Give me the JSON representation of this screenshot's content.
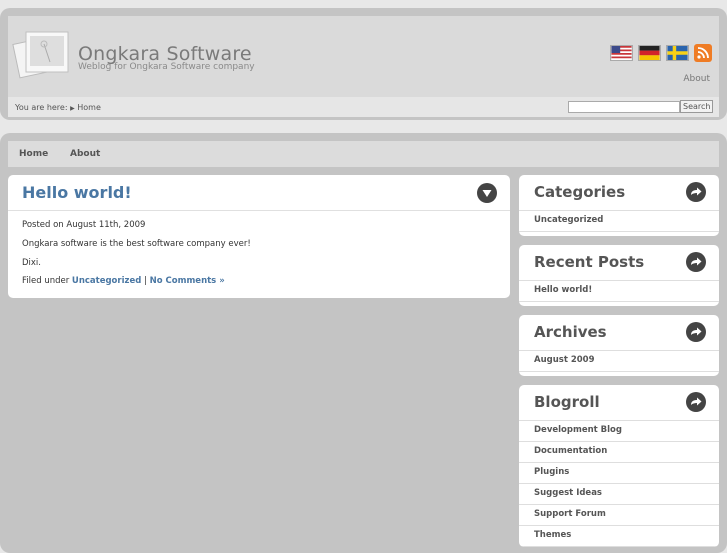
{
  "header": {
    "site_title": "Ongkara Software",
    "tagline": "Weblog for Ongkara Software company",
    "languages": [
      {
        "name": "English",
        "icon": "us-flag-icon"
      },
      {
        "name": "German",
        "icon": "de-flag-icon"
      },
      {
        "name": "Swedish",
        "icon": "se-flag-icon"
      }
    ],
    "rss_icon": "rss-icon",
    "about_label": "About",
    "breadcrumb_prefix": "You are here:",
    "breadcrumb_separator": "▶",
    "breadcrumb_home": "Home",
    "search": {
      "value": "",
      "placeholder": "",
      "button_label": "Search"
    }
  },
  "nav": {
    "items": [
      {
        "label": "Home"
      },
      {
        "label": "About"
      }
    ]
  },
  "post": {
    "title": "Hello world!",
    "posted_on": "Posted on August 11th, 2009",
    "body": [
      "Ongkara software is the best software company ever!",
      "Dixi."
    ],
    "filed_under_label": "Filed under",
    "category": "Uncategorized",
    "separator": "|",
    "comments_link": "No Comments »"
  },
  "sidebar": {
    "widgets": [
      {
        "title": "Categories",
        "items": [
          "Uncategorized"
        ]
      },
      {
        "title": "Recent Posts",
        "items": [
          "Hello world!"
        ]
      },
      {
        "title": "Archives",
        "items": [
          "August 2009"
        ]
      },
      {
        "title": "Blogroll",
        "items": [
          "Development Blog",
          "Documentation",
          "Plugins",
          "Suggest Ideas",
          "Support Forum",
          "Themes"
        ]
      }
    ]
  },
  "colors": {
    "link": "#4a77a3",
    "frame": "#c4c4c4",
    "rss": "#ef7c25"
  }
}
